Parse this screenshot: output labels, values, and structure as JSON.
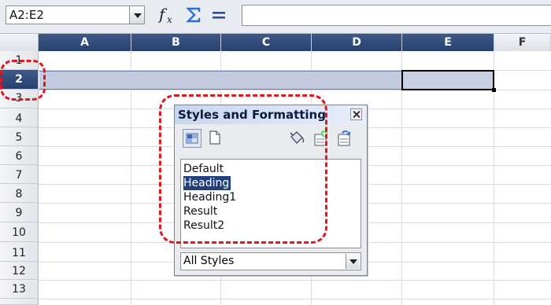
{
  "formula_bar": {
    "name_box_value": "A2:E2",
    "formula_value": ""
  },
  "columns": [
    "A",
    "B",
    "C",
    "D",
    "E",
    "F"
  ],
  "rows": [
    "1",
    "2",
    "3",
    "4",
    "5",
    "6",
    "7",
    "8",
    "9",
    "10",
    "11",
    "12",
    "13"
  ],
  "selection": {
    "row": "2",
    "range": "A2:E2"
  },
  "dialog": {
    "title": "Styles and Formatting",
    "styles": [
      "Default",
      "Heading",
      "Heading1",
      "Result",
      "Result2"
    ],
    "selected_style": "Heading",
    "filter_value": "All Styles"
  },
  "colors": {
    "selection_header": "#26416e",
    "annotation": "#e3161d"
  }
}
